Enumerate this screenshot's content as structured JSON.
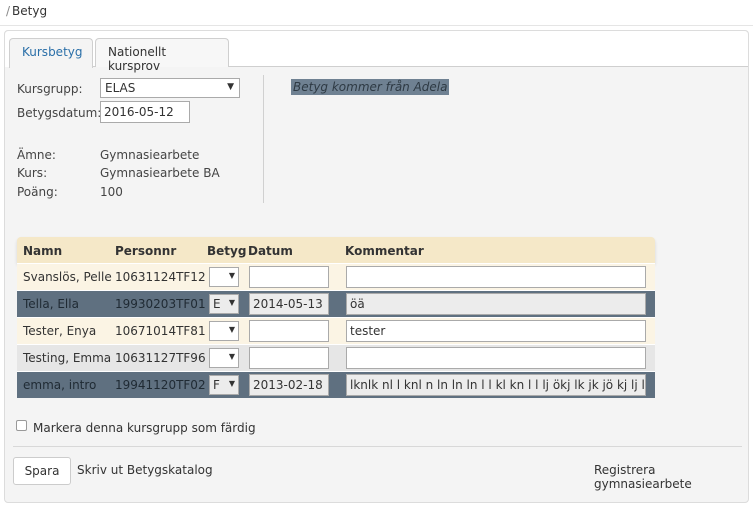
{
  "breadcrumb": {
    "separator": "/",
    "current": "Betyg"
  },
  "tabs": [
    {
      "label": "Kursbetyg",
      "active": true
    },
    {
      "label": "Nationellt kursprov",
      "active": false
    }
  ],
  "form": {
    "kursgrupp_label": "Kursgrupp:",
    "kursgrupp_value": "ELAS",
    "betygsdatum_label": "Betygsdatum:",
    "betygsdatum_value": "2016-05-12",
    "amne_label": "Ämne:",
    "amne_value": "Gymnasiearbete",
    "kurs_label": "Kurs:",
    "kurs_value": "Gymnasiearbete BA",
    "poang_label": "Poäng:",
    "poang_value": "100"
  },
  "source_note": "Betyg kommer från Adela",
  "grid": {
    "headers": {
      "namn": "Namn",
      "personnr": "Personnr",
      "betyg": "Betyg",
      "datum": "Datum",
      "kommentar": "Kommentar"
    },
    "rows": [
      {
        "namn": "Svanslös, Pelle",
        "personnr": "10631124TF12",
        "betyg": "",
        "datum": "",
        "kommentar": ""
      },
      {
        "namn": "Tella, Ella",
        "personnr": "19930203TF01",
        "betyg": "E",
        "datum": "2014-05-13",
        "kommentar": "öä"
      },
      {
        "namn": "Tester, Enya",
        "personnr": "10671014TF81",
        "betyg": "",
        "datum": "",
        "kommentar": "tester"
      },
      {
        "namn": "Testing, Emma",
        "personnr": "10631127TF96",
        "betyg": "",
        "datum": "",
        "kommentar": ""
      },
      {
        "namn": "emma, intro",
        "personnr": "19941120TF02",
        "betyg": "F",
        "datum": "2013-02-18",
        "kommentar": "lknlk nl l knl n ln ln ln l l kl kn l l lj ökj lk jk jö kj lj lh kjh"
      }
    ]
  },
  "complete_checkbox": {
    "label": "Markera denna kursgrupp som färdig",
    "checked": false
  },
  "actions": {
    "save": "Spara",
    "print": "Skriv ut Betygskatalog",
    "register": "Registrera gymnasiearbete"
  },
  "colors": {
    "header_bg": "#f5e8c8",
    "locked_row": "#5f7080",
    "active_tab_text": "#2a6fa8"
  }
}
